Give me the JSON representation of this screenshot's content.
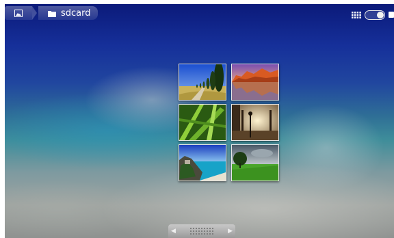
{
  "breadcrumb": {
    "home_icon": "image-icon",
    "folder_icon": "folder-icon",
    "folder_label": "sdcard"
  },
  "toolbar": {
    "grid_icon": "grid-view-icon",
    "toggle_icon": "toggle-switch-icon",
    "camera_icon": "camera-icon"
  },
  "thumbnails": [
    {
      "name": "cypress-road"
    },
    {
      "name": "canyon-lake-sunset"
    },
    {
      "name": "green-grass"
    },
    {
      "name": "venice-plaza"
    },
    {
      "name": "tropical-coast"
    },
    {
      "name": "green-field"
    }
  ],
  "scrubber": {
    "left_icon": "arrow-left-icon",
    "right_icon": "arrow-right-icon"
  }
}
